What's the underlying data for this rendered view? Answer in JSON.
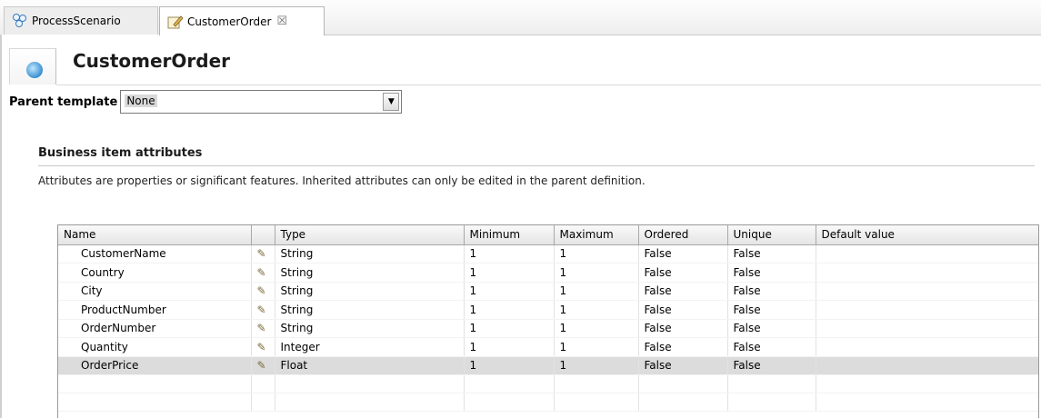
{
  "tabs": [
    {
      "label": "ProcessScenario",
      "icon": "process-scenario-icon"
    },
    {
      "label": "CustomerOrder",
      "icon": "business-item-edit-icon",
      "close": "☒"
    }
  ],
  "header": {
    "title": "CustomerOrder",
    "icon": "business-item-icon"
  },
  "parent_template": {
    "label": "Parent template",
    "value": "None"
  },
  "section": {
    "title": "Business item attributes",
    "description": "Attributes are properties or significant features. Inherited attributes can only be edited in the parent definition."
  },
  "table": {
    "columns": [
      "Name",
      "",
      "Type",
      "Minimum",
      "Maximum",
      "Ordered",
      "Unique",
      "Default value"
    ],
    "rows": [
      {
        "name": "CustomerName",
        "type": "String",
        "min": "1",
        "max": "1",
        "ordered": "False",
        "unique": "False",
        "default": ""
      },
      {
        "name": "Country",
        "type": "String",
        "min": "1",
        "max": "1",
        "ordered": "False",
        "unique": "False",
        "default": ""
      },
      {
        "name": "City",
        "type": "String",
        "min": "1",
        "max": "1",
        "ordered": "False",
        "unique": "False",
        "default": ""
      },
      {
        "name": "ProductNumber",
        "type": "String",
        "min": "1",
        "max": "1",
        "ordered": "False",
        "unique": "False",
        "default": ""
      },
      {
        "name": "OrderNumber",
        "type": "String",
        "min": "1",
        "max": "1",
        "ordered": "False",
        "unique": "False",
        "default": ""
      },
      {
        "name": "Quantity",
        "type": "Integer",
        "min": "1",
        "max": "1",
        "ordered": "False",
        "unique": "False",
        "default": ""
      },
      {
        "name": "OrderPrice",
        "type": "Float",
        "min": "1",
        "max": "1",
        "ordered": "False",
        "unique": "False",
        "default": ""
      }
    ],
    "selected_row": 6
  }
}
